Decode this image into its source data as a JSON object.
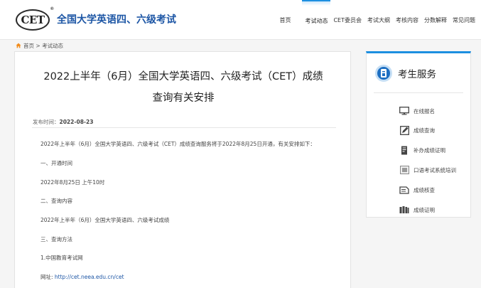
{
  "header": {
    "logo_text": "CET",
    "logo_mark": "®",
    "site_title": "全国大学英语四、六级考试",
    "nav": [
      {
        "label": "首页",
        "active": false
      },
      {
        "label": "考试动态",
        "active": true
      },
      {
        "label": "CET委员会",
        "active": false
      },
      {
        "label": "考试大纲",
        "active": false
      },
      {
        "label": "考核内容",
        "active": false
      },
      {
        "label": "分数解释",
        "active": false
      },
      {
        "label": "常见问题",
        "active": false
      }
    ]
  },
  "breadcrumb": {
    "icon": "home-icon",
    "home": "首页",
    "sep": " > ",
    "current": "考试动态"
  },
  "article": {
    "title_line1": "2022上半年（6月）全国大学英语四、六级考试（CET）成绩",
    "title_line2": "查询有关安排",
    "pub_label": "发布时间：",
    "pub_date": "2022-08-23",
    "paragraphs": [
      "2022年上半年（6月）全国大学英语四、六级考试（CET）成绩查询服务将于2022年8月25日开通，有关安排如下：",
      "一、开通时间",
      "2022年8月25日 上午10时",
      "二、查询内容",
      "2022年上半年（6月）全国大学英语四、六级考试成绩",
      "三、查询方法",
      "1.中国教育考试网"
    ],
    "url_label": "网址: ",
    "url": "http://cet.neea.edu.cn/cet"
  },
  "sidebar": {
    "title": "考生服务",
    "items": [
      {
        "label": "在线报名",
        "icon": "monitor-icon"
      },
      {
        "label": "成绩查询",
        "icon": "edit-icon"
      },
      {
        "label": "补办成绩证明",
        "icon": "certificate-icon"
      },
      {
        "label": "口语考试系统培训",
        "icon": "training-icon"
      },
      {
        "label": "成绩核查",
        "icon": "check-icon"
      },
      {
        "label": "成绩证明",
        "icon": "book-icon"
      }
    ]
  },
  "colors": {
    "brand_blue": "#1d56a5",
    "accent": "#1d8fe0"
  }
}
